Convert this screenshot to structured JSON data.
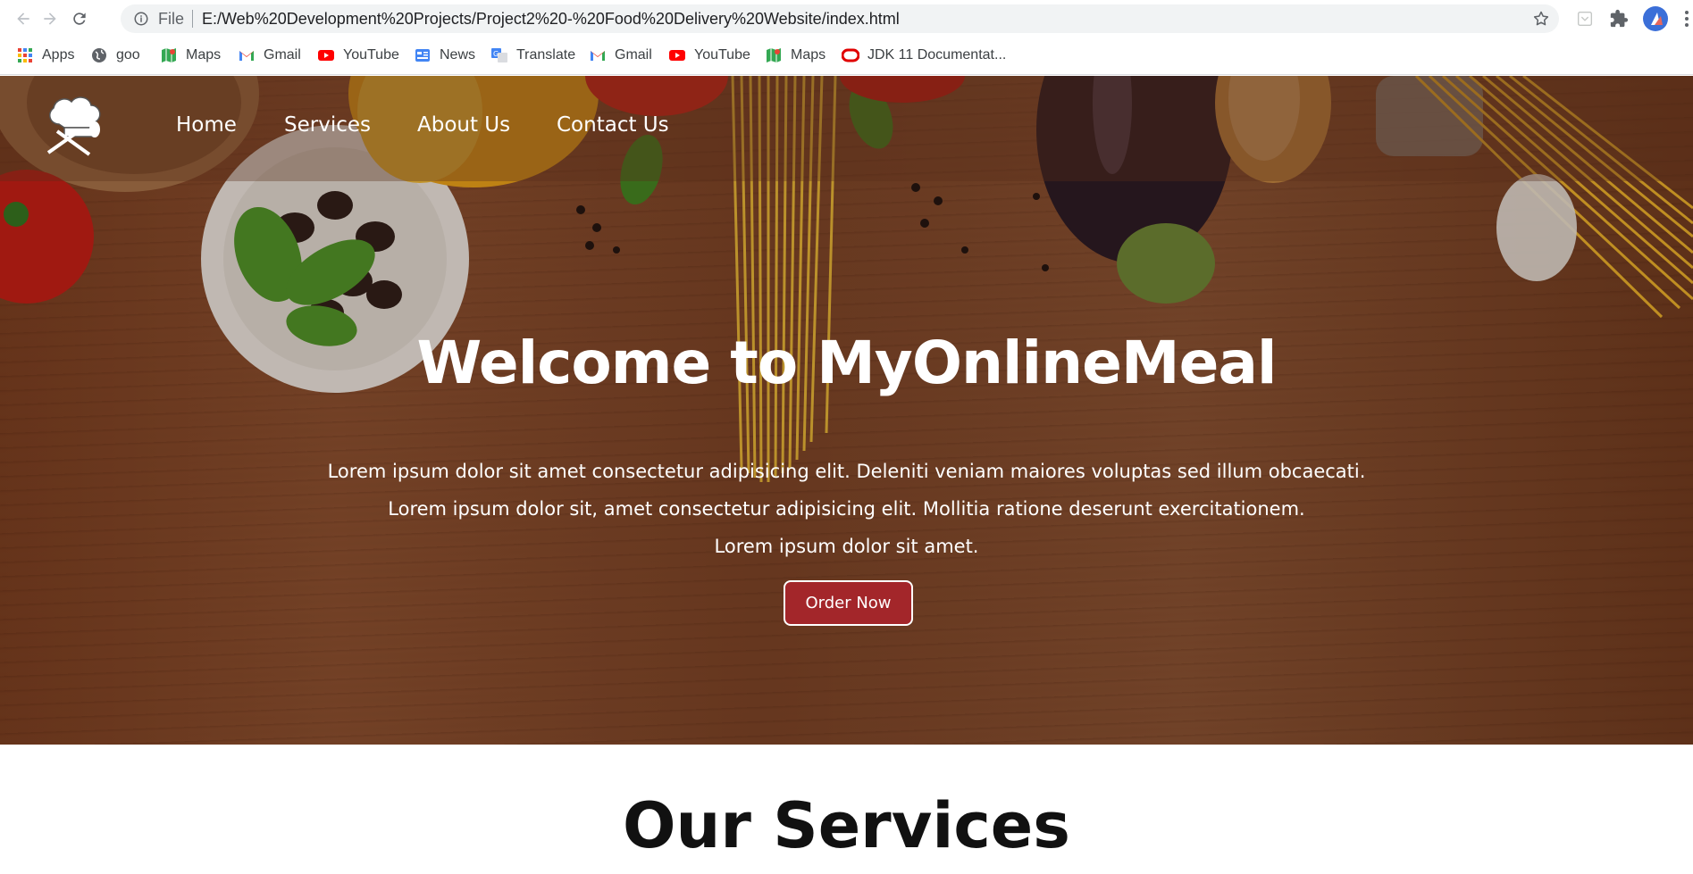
{
  "browser": {
    "omnibox": {
      "scheme_label": "File",
      "url": "E:/Web%20Development%20Projects/Project2%20-%20Food%20Delivery%20Website/index.html"
    },
    "icons": [
      "back-icon",
      "forward-icon",
      "reload-icon",
      "info-icon",
      "star-icon",
      "extension-icon",
      "puzzle-icon",
      "profile-avatar",
      "more-icon"
    ],
    "bookmarks": [
      {
        "label": "Apps",
        "icon": "apps-grid-icon"
      },
      {
        "label": "goo",
        "icon": "globe-icon"
      },
      {
        "label": "Maps",
        "icon": "maps-icon"
      },
      {
        "label": "Gmail",
        "icon": "gmail-icon"
      },
      {
        "label": "YouTube",
        "icon": "youtube-icon"
      },
      {
        "label": "News",
        "icon": "news-icon"
      },
      {
        "label": "Translate",
        "icon": "translate-icon"
      },
      {
        "label": "Gmail",
        "icon": "gmail-icon"
      },
      {
        "label": "YouTube",
        "icon": "youtube-icon"
      },
      {
        "label": "Maps",
        "icon": "maps-icon"
      },
      {
        "label": "JDK 11 Documentat...",
        "icon": "oracle-icon"
      }
    ]
  },
  "site": {
    "logo_icon": "chef-hat-icon",
    "nav": [
      {
        "label": "Home"
      },
      {
        "label": "Services"
      },
      {
        "label": "About Us"
      },
      {
        "label": "Contact Us"
      }
    ],
    "hero": {
      "title": "Welcome to MyOnlineMeal",
      "lines": [
        "Lorem ipsum dolor sit amet consectetur adipisicing elit. Deleniti veniam maiores voluptas sed illum obcaecati.",
        "Lorem ipsum dolor sit, amet consectetur adipisicing elit. Mollitia ratione deserunt exercitationem.",
        "Lorem ipsum dolor sit amet."
      ],
      "cta_label": "Order Now"
    },
    "services_title": "Our Services"
  },
  "colors": {
    "accent": "#a3262a",
    "hero_wood": "#7b4428",
    "text_light": "#ffffff"
  }
}
